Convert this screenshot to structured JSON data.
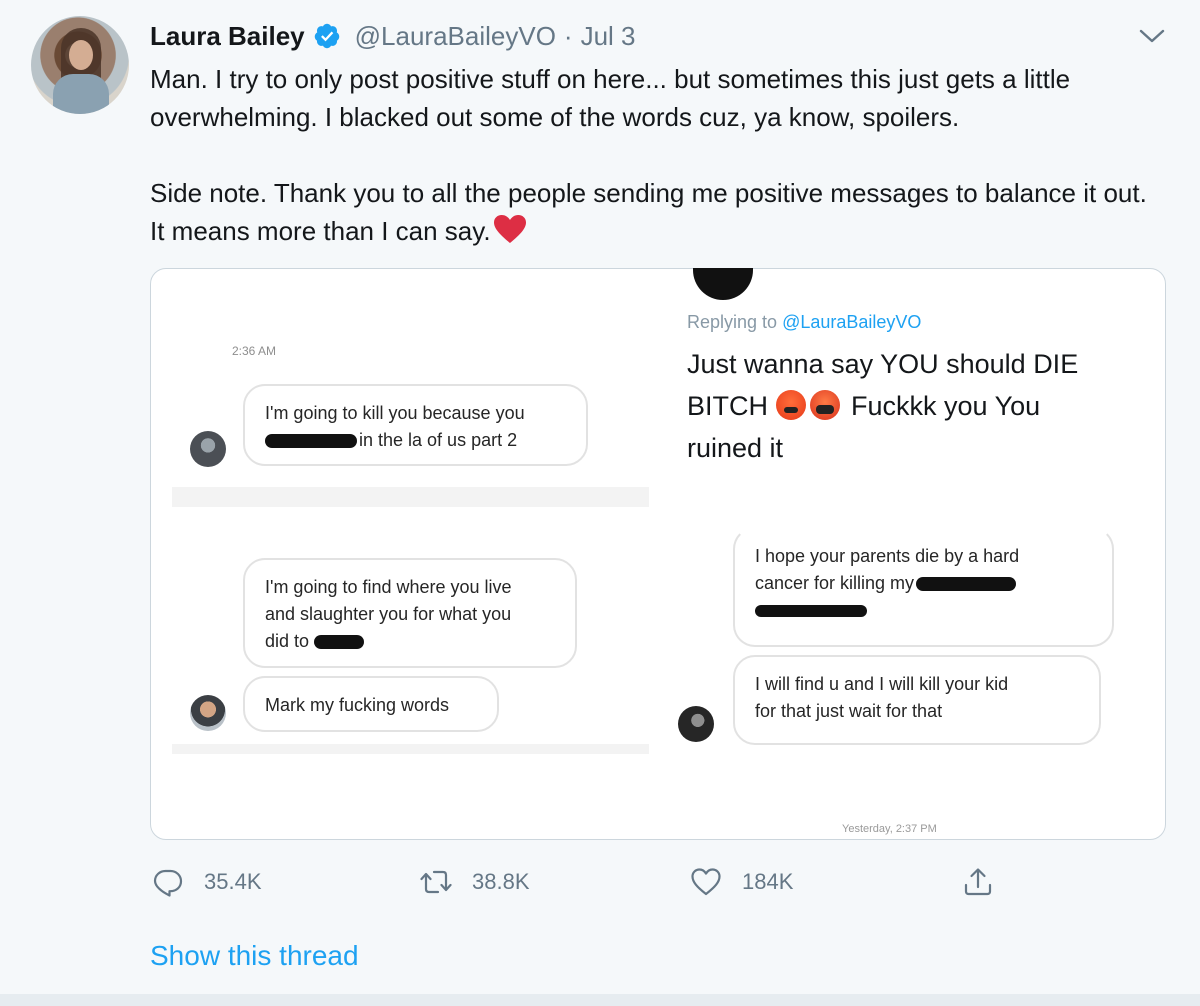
{
  "tweet": {
    "display_name": "Laura Bailey",
    "handle": "@LauraBaileyVO",
    "separator": "·",
    "date": "Jul 3",
    "text_para1": "Man. I try to only post positive stuff on here... but sometimes this just gets a little overwhelming. I blacked out some of the words cuz, ya know, spoilers.",
    "text_para2": "Side note. Thank you to all the people sending me positive messages to balance it out. It means more than I can say."
  },
  "media": {
    "dm_time": "2:36 AM",
    "message1_line1": "I'm going to kill you because you",
    "message1_line2": "in the la of us part 2",
    "message2_line1": "I'm going to find where you live",
    "message2_line2": "and slaughter you for what you",
    "message2_line3": "did to",
    "message3": "Mark my fucking words",
    "replying_prefix": "Replying to",
    "replying_mention": "@LauraBaileyVO",
    "reply_line1": "Just wanna say YOU should DIE",
    "reply_line2_a": "BITCH",
    "reply_line2_b": "Fuckkk you You",
    "reply_line3": "ruined it",
    "message4_line1": "I hope your parents die by a hard",
    "message4_line2": "cancer for killing my",
    "message5_line1": "I will find u and I will kill your kid",
    "message5_line2": "for that just wait for that",
    "yesterday": "Yesterday, 2:37 PM"
  },
  "actions": {
    "reply_count": "35.4K",
    "retweet_count": "38.8K",
    "like_count": "184K"
  },
  "show_thread": "Show this thread",
  "icons": {
    "verified": "verified-badge-icon",
    "chevron": "chevron-down-icon",
    "heart_emoji": "red-heart-emoji",
    "reply": "reply-icon",
    "retweet": "retweet-icon",
    "like": "like-heart-icon",
    "share": "share-icon"
  },
  "colors": {
    "accent": "#1da1f2",
    "muted": "#657786",
    "background": "#f5f8fa"
  }
}
